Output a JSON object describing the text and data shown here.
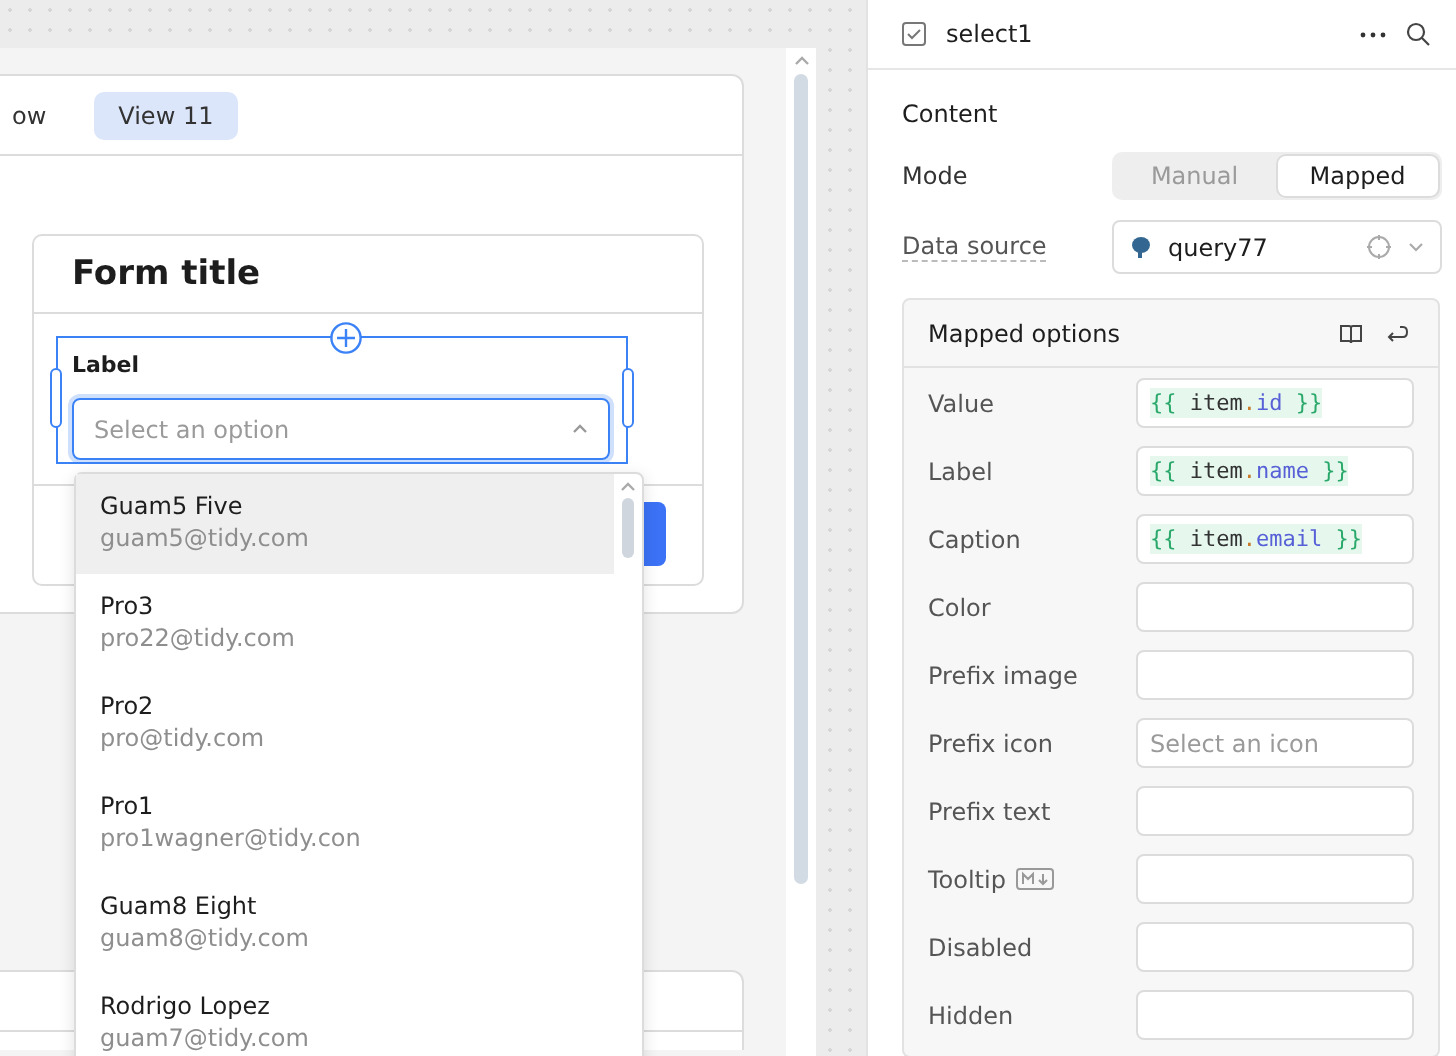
{
  "canvas": {
    "tabs": [
      {
        "label": "ow",
        "selected": false
      },
      {
        "label": "View 11",
        "selected": true
      }
    ],
    "form": {
      "title": "Form title",
      "field_label": "Label",
      "placeholder": "Select an option"
    },
    "dropdown": [
      {
        "name": "Guam5 Five",
        "email": "guam5@tidy.com",
        "highlighted": true
      },
      {
        "name": "Pro3",
        "email": "pro22@tidy.com",
        "highlighted": false
      },
      {
        "name": "Pro2",
        "email": "pro@tidy.com",
        "highlighted": false
      },
      {
        "name": "Pro1",
        "email": "pro1wagner@tidy.con",
        "highlighted": false
      },
      {
        "name": "Guam8 Eight",
        "email": "guam8@tidy.com",
        "highlighted": false
      },
      {
        "name": "Rodrigo Lopez",
        "email": "guam7@tidy.com",
        "highlighted": false
      }
    ]
  },
  "inspector": {
    "component": "select1",
    "section": "Content",
    "mode": {
      "label": "Mode",
      "options": [
        {
          "label": "Manual",
          "selected": false
        },
        {
          "label": "Mapped",
          "selected": true
        }
      ]
    },
    "data_source": {
      "label": "Data source",
      "value": "query77"
    },
    "mapped_options": {
      "title": "Mapped options",
      "rows": [
        {
          "label": "Value",
          "kind": "code",
          "value": "{{ item.id }}"
        },
        {
          "label": "Label",
          "kind": "code",
          "value": "{{ item.name }}"
        },
        {
          "label": "Caption",
          "kind": "code",
          "value": "{{ item.email }}"
        },
        {
          "label": "Color",
          "kind": "empty"
        },
        {
          "label": "Prefix image",
          "kind": "empty"
        },
        {
          "label": "Prefix icon",
          "kind": "picker",
          "placeholder": "Select an icon"
        },
        {
          "label": "Prefix text",
          "kind": "empty"
        },
        {
          "label": "Tooltip",
          "kind": "markdown"
        },
        {
          "label": "Disabled",
          "kind": "empty"
        },
        {
          "label": "Hidden",
          "kind": "empty"
        }
      ]
    }
  }
}
